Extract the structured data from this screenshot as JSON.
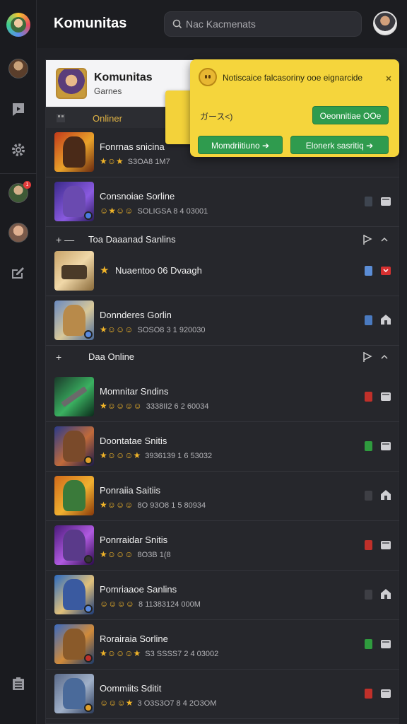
{
  "header": {
    "title": "Komunitas",
    "search_placeholder": "Nac Kacmenats"
  },
  "community": {
    "name": "Komunitas",
    "subtitle": "Garnes",
    "online_tab": "Onliner"
  },
  "popup": {
    "message": "Notiscaice falcasoriny ooe eignarcide",
    "code": "ガース<)",
    "primary_button": "Oeonnitiae OOe",
    "button_left": "Momdriitiuno ➔",
    "button_right": "Elonerk sasritiq ➔"
  },
  "rows_top": [
    {
      "name": "Fonrnas snicina",
      "emojis": "★☺★",
      "digits": "S3OA8 1M7"
    },
    {
      "name": "Consnoiae Sorline",
      "emojis": "☺★☺☺",
      "digits": "SOLIGSA 8 4 03001"
    }
  ],
  "section1": {
    "left": "+ —",
    "title": "Toa Daaanad Sanlins"
  },
  "rows_mid": [
    {
      "name": "Nuaentoo 06 Dvaagh",
      "emojis": "★",
      "digits": ""
    },
    {
      "name": "Donnderes Gorlin",
      "emojis": "★☺☺☺",
      "digits": "SOSO8 3 1 920030"
    }
  ],
  "section2": {
    "left": "+",
    "title": "Daa Online"
  },
  "rows_bottom": [
    {
      "name": "Momnitar Sndins",
      "emojis": "★☺☺☺☺",
      "digits": "3338II2 6 2 60034"
    },
    {
      "name": "Doontatae Snitis",
      "emojis": "★☺☺☺★",
      "digits": "3936139 1 6 53032"
    },
    {
      "name": "Ponraiia Saitiis",
      "emojis": "★☺☺☺",
      "digits": "8O 93O8 1 5 80934"
    },
    {
      "name": "Ponrraidar Snitis",
      "emojis": "★☺☺☺",
      "digits": "8O3B 1(8"
    },
    {
      "name": "Pomriaaoe Sanlins",
      "emojis": "☺☺☺☺",
      "digits": "8 11383124 000M"
    },
    {
      "name": "Rorairaia Sorline",
      "emojis": "★☺☺☺★",
      "digits": "S3 SSSS7 2 4 03002"
    },
    {
      "name": "Oommiits Sditit",
      "emojis": "☺☺☺★",
      "digits": "3 O3S3O7 8 4 2O3OM"
    }
  ],
  "colors": {
    "accent_yellow": "#f5d53c",
    "button_green": "#2f9b4e",
    "background": "#202126",
    "online_label": "#e0b345"
  },
  "icons": [
    "user-avatar-icon",
    "chat-icon",
    "gear-icon",
    "notification-avatar-icon",
    "friend-avatar-icon",
    "edit-icon",
    "list-icon",
    "search-icon",
    "close-icon",
    "flag-icon",
    "chevron-up-icon",
    "house-icon",
    "gift-icon"
  ]
}
